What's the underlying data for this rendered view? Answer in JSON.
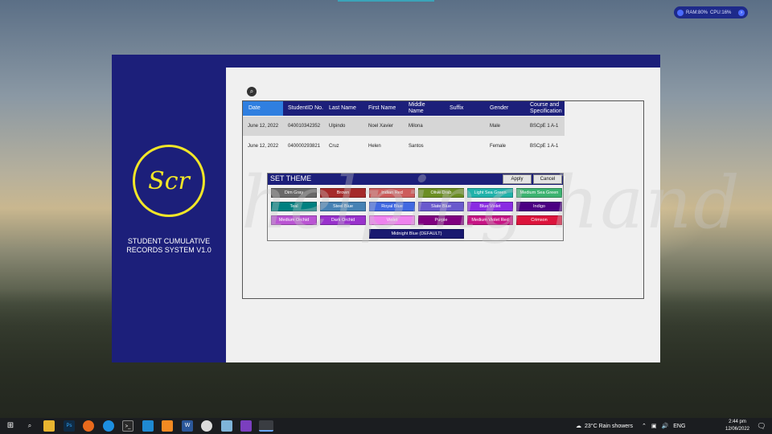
{
  "system": {
    "ram": "RAM:80%",
    "cpu": "CPU:16%"
  },
  "app": {
    "logo_text": "Scr",
    "name_line1": "STUDENT CUMULATIVE",
    "name_line2": "RECORDS SYSTEM V1.0"
  },
  "grid": {
    "columns": [
      {
        "label": "Date"
      },
      {
        "label": "StudentID No."
      },
      {
        "label": "Last Name"
      },
      {
        "label": "First Name"
      },
      {
        "label": "Middle Name"
      },
      {
        "label": "Suffix"
      },
      {
        "label": "Gender"
      },
      {
        "label": "Course and Specification"
      }
    ],
    "rows": [
      {
        "date": "June 12, 2022",
        "student_id": "040010342352",
        "last": "Ulpindo",
        "first": "Noel Xavier",
        "middle": "Milona",
        "suffix": "",
        "gender": "Male",
        "course": "BSCpE 1 A-1"
      },
      {
        "date": "June 12, 2022",
        "student_id": "040000293821",
        "last": "Cruz",
        "first": "Helen",
        "middle": "Santos",
        "suffix": "",
        "gender": "Female",
        "course": "BSCpE 1 A-1"
      }
    ]
  },
  "theme_dialog": {
    "title": "SET THEME",
    "apply": "Apply",
    "cancel": "Cancel",
    "swatches": [
      {
        "label": "Dim Gray",
        "color": "#696969"
      },
      {
        "label": "Brown",
        "color": "#a52a2a"
      },
      {
        "label": "Indian Red",
        "color": "#cd5c5c"
      },
      {
        "label": "Olive Drab",
        "color": "#6b8e23"
      },
      {
        "label": "Light Sea Green",
        "color": "#20b2aa"
      },
      {
        "label": "Medium Sea Green",
        "color": "#3cb371"
      },
      {
        "label": "Teal",
        "color": "#008080"
      },
      {
        "label": "Steel Blue",
        "color": "#4682b4"
      },
      {
        "label": "Royal Blue",
        "color": "#4169e1"
      },
      {
        "label": "Slate Blue",
        "color": "#6a5acd"
      },
      {
        "label": "Blue Violet",
        "color": "#8a2be2"
      },
      {
        "label": "Indigo",
        "color": "#4b0082"
      },
      {
        "label": "Medium Orchid",
        "color": "#ba55d3"
      },
      {
        "label": "Dark Orchid",
        "color": "#9932cc"
      },
      {
        "label": "Violet",
        "color": "#ee82ee"
      },
      {
        "label": "Purple",
        "color": "#800080"
      },
      {
        "label": "Medium Violet Red",
        "color": "#c71585"
      },
      {
        "label": "Crimson",
        "color": "#dc143c"
      },
      {
        "label": "Midnight Blue (DEFAULT)",
        "color": "#191970"
      }
    ]
  },
  "watermark": "helping hand",
  "taskbar": {
    "weather": "23°C  Rain showers",
    "lang": "ENG",
    "time": "2:44 pm",
    "date": "12/06/2022",
    "apps": [
      "start-icon",
      "search-icon",
      "file-explorer-icon",
      "photoshop-icon",
      "firefox-icon",
      "edge-icon",
      "terminal-icon",
      "vscode-icon",
      "xampp-icon",
      "word-icon",
      "chrome-icon",
      "notepad-icon",
      "visual-studio-icon",
      "app-icon"
    ]
  }
}
